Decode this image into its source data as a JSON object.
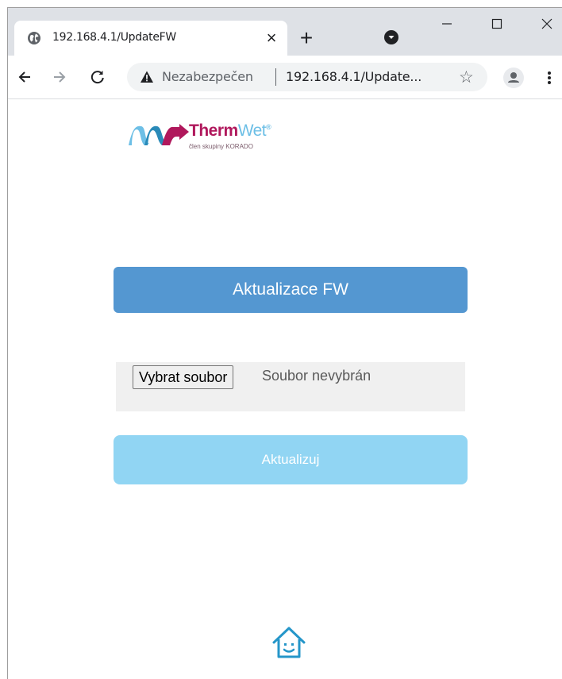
{
  "browser": {
    "tab": {
      "title": "192.168.4.1/UpdateFW",
      "close_symbol": "×",
      "favicon": "globe-icon"
    },
    "new_tab_symbol": "+",
    "omnibox": {
      "security_label": "Nezabezpečen",
      "url": "192.168.4.1/Update...",
      "star_symbol": "☆"
    }
  },
  "page": {
    "logo": {
      "name_part1": "Therm",
      "name_part2": "Wet",
      "registered": "®",
      "tagline": "člen skupiny KORADO"
    },
    "heading": "Aktualizace FW",
    "file_input": {
      "button_label": "Vybrat soubor",
      "status": "Soubor nevybrán"
    },
    "submit_label": "Aktualizuj"
  },
  "colors": {
    "heading_bg": "#5497d1",
    "submit_bg": "#91d5f3",
    "brand_magenta": "#b0185c",
    "brand_blue": "#6dbfe6"
  }
}
